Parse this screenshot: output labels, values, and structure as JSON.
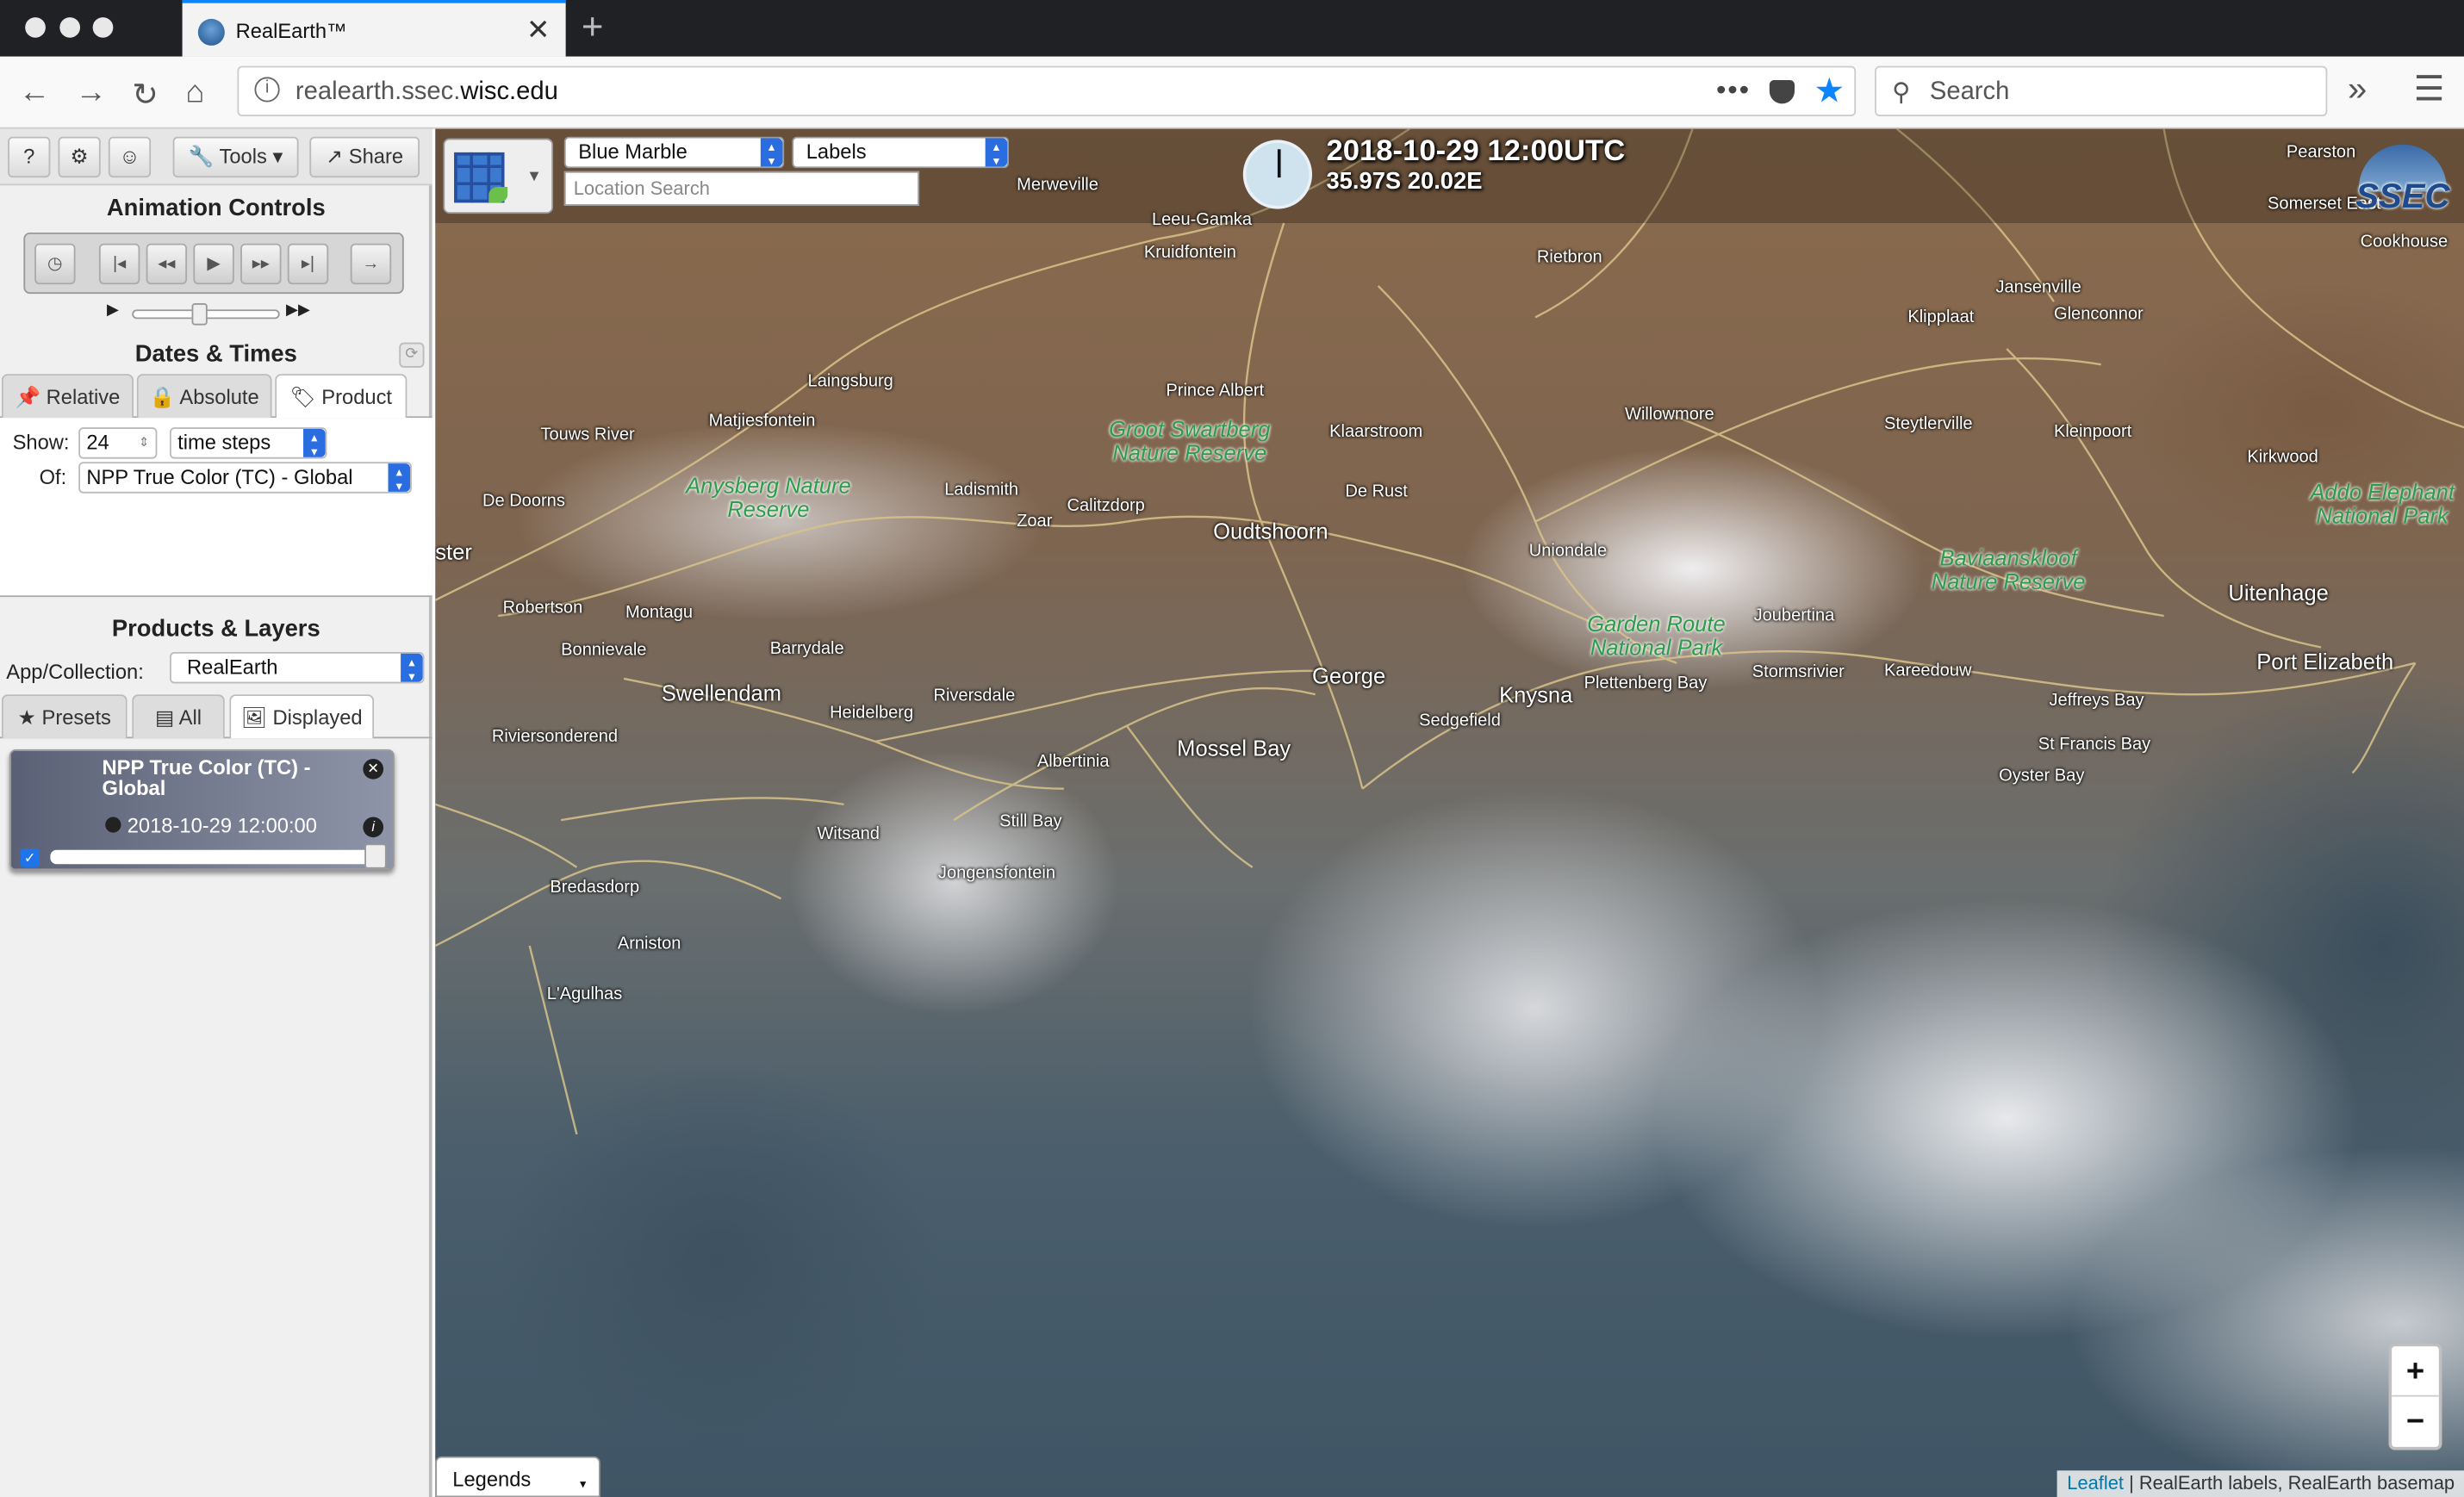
{
  "browser": {
    "tab_title": "RealEarth™",
    "url_prefix": "realearth.ssec.",
    "url_domain": "wisc.edu",
    "search_placeholder": "Search"
  },
  "sidebar": {
    "buttons": {
      "help": "?",
      "tools": "Tools",
      "share": "Share"
    },
    "animation_title": "Animation Controls",
    "dates_title": "Dates & Times",
    "date_tabs": [
      "Relative",
      "Absolute",
      "Product"
    ],
    "active_date_tab": "Product",
    "show_label": "Show:",
    "show_value": "24",
    "steps_value": "time steps",
    "of_label": "Of:",
    "of_value": "NPP True Color (TC) - Global",
    "products_title": "Products & Layers",
    "collection_label": "App/Collection:",
    "collection_value": "RealEarth",
    "product_tabs": [
      "Presets",
      "All",
      "Displayed"
    ],
    "active_product_tab": "Displayed",
    "layer": {
      "name": "NPP True Color (TC) - Global",
      "time": "2018-10-29 12:00:00",
      "opacity": 1.0
    }
  },
  "map": {
    "basemap": "Blue Marble",
    "overlay": "Labels",
    "location_placeholder": "Location Search",
    "timestamp": "2018-10-29 12:00UTC",
    "coords": "35.97S 20.02E",
    "logo_text": "SSEC",
    "zoom_in": "+",
    "zoom_out": "−",
    "legends_label": "Legends",
    "attribution_link": "Leaflet",
    "attribution_text": "| RealEarth labels, RealEarth basemap",
    "places": [
      {
        "name": "Merweville",
        "key": "p0"
      },
      {
        "name": "Leeu-Gamka",
        "key": "p1"
      },
      {
        "name": "Kruidfontein",
        "key": "p2"
      },
      {
        "name": "Rietbron",
        "key": "p3"
      },
      {
        "name": "Pearston",
        "key": "p4"
      },
      {
        "name": "Somerset East",
        "key": "p5"
      },
      {
        "name": "Cookhouse",
        "key": "p6"
      },
      {
        "name": "Jansenville",
        "key": "p7"
      },
      {
        "name": "Klipplaat",
        "key": "p8"
      },
      {
        "name": "Glenconnor",
        "key": "p9"
      },
      {
        "name": "Laingsburg",
        "key": "p10"
      },
      {
        "name": "Prince Albert",
        "key": "p11"
      },
      {
        "name": "Touws River",
        "key": "p12"
      },
      {
        "name": "Matjiesfontein",
        "key": "p13"
      },
      {
        "name": "Klaarstroom",
        "key": "p14"
      },
      {
        "name": "Willowmore",
        "key": "p15"
      },
      {
        "name": "Steytlerville",
        "key": "p16"
      },
      {
        "name": "Kleinpoort",
        "key": "p17"
      },
      {
        "name": "Kirkwood",
        "key": "p18"
      },
      {
        "name": "De Doorns",
        "key": "p19"
      },
      {
        "name": "Ladismith",
        "key": "p20"
      },
      {
        "name": "Zoar",
        "key": "p21"
      },
      {
        "name": "Calitzdorp",
        "key": "p22"
      },
      {
        "name": "De Rust",
        "key": "p23"
      },
      {
        "name": "Oudtshoorn",
        "key": "p24"
      },
      {
        "name": "Uniondale",
        "key": "p25"
      },
      {
        "name": "Robertson",
        "key": "p26"
      },
      {
        "name": "Montagu",
        "key": "p27"
      },
      {
        "name": "Bonnievale",
        "key": "p28"
      },
      {
        "name": "Barrydale",
        "key": "p29"
      },
      {
        "name": "Joubertina",
        "key": "p30"
      },
      {
        "name": "Uitenhage",
        "key": "p31"
      },
      {
        "name": "Swellendam",
        "key": "p32"
      },
      {
        "name": "Riversdale",
        "key": "p33"
      },
      {
        "name": "Heidelberg",
        "key": "p34"
      },
      {
        "name": "George",
        "key": "p35"
      },
      {
        "name": "Knysna",
        "key": "p36"
      },
      {
        "name": "Plettenberg Bay",
        "key": "p37"
      },
      {
        "name": "Stormsrivier",
        "key": "p38"
      },
      {
        "name": "Kareedouw",
        "key": "p39"
      },
      {
        "name": "Port Elizabeth",
        "key": "p40"
      },
      {
        "name": "Jeffreys Bay",
        "key": "p41"
      },
      {
        "name": "Sedgefield",
        "key": "p42"
      },
      {
        "name": "Riviersonderend",
        "key": "p43"
      },
      {
        "name": "Mossel Bay",
        "key": "p44"
      },
      {
        "name": "Albertinia",
        "key": "p45"
      },
      {
        "name": "St Francis Bay",
        "key": "p46"
      },
      {
        "name": "Oyster Bay",
        "key": "p47"
      },
      {
        "name": "Witsand",
        "key": "p48"
      },
      {
        "name": "Still Bay",
        "key": "p49"
      },
      {
        "name": "Jongensfontein",
        "key": "p50"
      },
      {
        "name": "Bredasdorp",
        "key": "p51"
      },
      {
        "name": "Arniston",
        "key": "p52"
      },
      {
        "name": "L'Agulhas",
        "key": "p53"
      },
      {
        "name": "ster",
        "key": "p54"
      }
    ],
    "parks": [
      {
        "name": "Groot Swartberg Nature Reserve"
      },
      {
        "name": "Anysberg Nature Reserve"
      },
      {
        "name": "Garden Route National Park"
      },
      {
        "name": "Baviaanskloof Nature Reserve"
      },
      {
        "name": "Addo Elephant National Park"
      }
    ]
  }
}
